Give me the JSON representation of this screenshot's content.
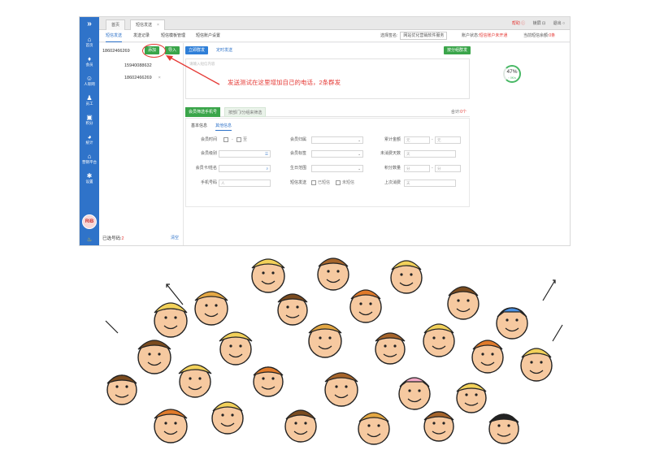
{
  "sidebar": {
    "collapse": "»",
    "items": [
      {
        "label": "首页",
        "icon": "home-icon",
        "glyph": "⌂"
      },
      {
        "label": "会员",
        "icon": "diamond-icon",
        "glyph": "♦"
      },
      {
        "label": "人际网",
        "icon": "people-icon",
        "glyph": "☺"
      },
      {
        "label": "员工",
        "icon": "user-icon",
        "glyph": "♟"
      },
      {
        "label": "积分",
        "icon": "id-card-icon",
        "glyph": "▣"
      },
      {
        "label": "统计",
        "icon": "pie-chart-icon",
        "glyph": "◕"
      },
      {
        "label": "营销平台",
        "icon": "shop-icon",
        "glyph": "⌂"
      },
      {
        "label": "设置",
        "icon": "gear-icon",
        "glyph": "✱"
      }
    ],
    "logo_text": "RiB",
    "bottom_glyph": "♨"
  },
  "topbar": {
    "tabs": [
      {
        "label": "首页"
      },
      {
        "label": "短信发送",
        "close": "×"
      }
    ],
    "right": {
      "help": "帮助 ⓘ",
      "lock": "锁屏 ⊡",
      "logout": "退出 ○"
    }
  },
  "subnav": {
    "tabs": [
      "短信发送",
      "发送记录",
      "短信模板管理",
      "短信账户设置"
    ],
    "signature_label": "选择签名:",
    "signature_value": "网站优化营销软件服务",
    "account_label": "账户状态:",
    "account_value": "短信账户未开通",
    "balance_label": "当前短信余额:",
    "balance_value": "0条"
  },
  "left": {
    "phone_value": "18602466269",
    "numbers": [
      "15940088632",
      "18602466269"
    ],
    "delete_glyph": "×",
    "selected_label": "已选号码:",
    "selected_count": "2",
    "clear_label": "清空"
  },
  "toolbar": {
    "add_label": "添加",
    "import_label": "导入",
    "send_now_label": "立即群发",
    "scheduled_label": "定时发送",
    "group_send_label": "按分组群发"
  },
  "editor": {
    "placeholder": "请输入短信内容"
  },
  "annotation": "发送测试在这里增加自己的电话，2条群发",
  "gauge": {
    "percent": "47",
    "unit": "%",
    "sub": "↑ 0K/s"
  },
  "member_tabs": {
    "tab1": "会员筛选手机号",
    "tab2": "按部门/分组来筛选",
    "right_label": "合计:",
    "right_value": "0个"
  },
  "filter": {
    "tabs": [
      "基本信息",
      "其他信息"
    ],
    "fields": {
      "register_time_label": "会员时间",
      "store_label": "会员归属",
      "consume_label": "累计金额",
      "level_label": "会员级别",
      "tag_label": "会员标签",
      "no_consume_label": "未消费天数",
      "name_label": "会员卡/姓名",
      "birthday_label": "生日范围",
      "points_label": "积分数量",
      "phone_label": "手机号码",
      "send_status_label": "短信发送",
      "last_consume_label": "上次消费"
    },
    "values": {
      "time_sep": "至",
      "from": "元",
      "to": "元",
      "points_from": "分",
      "points_to": "分",
      "days": "天",
      "phone_ph": "人",
      "last_ph": "天",
      "opt_yes": "已短信",
      "opt_no": "未短信",
      "range_sep": "-"
    }
  }
}
